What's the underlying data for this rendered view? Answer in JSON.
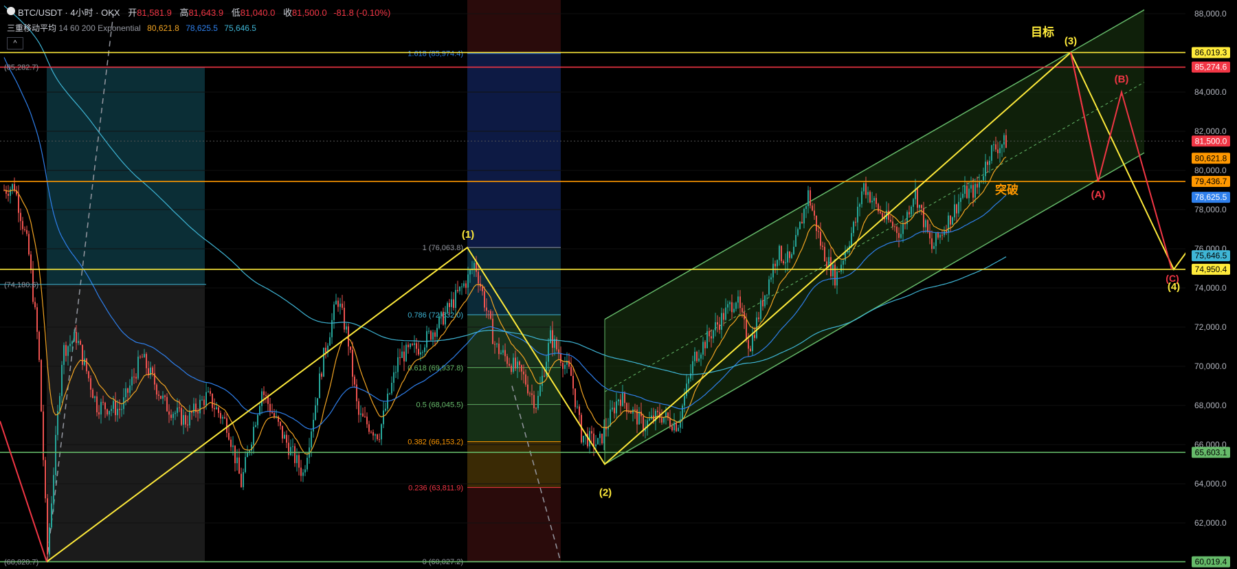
{
  "header": {
    "symbol": "BTC/USDT · 4小时 · OKX",
    "open_label": "开",
    "open": "81,581.9",
    "high_label": "高",
    "high": "81,643.9",
    "low_label": "低",
    "low": "81,040.0",
    "close_label": "收",
    "close": "81,500.0",
    "change": "-81.8 (-0.10%)"
  },
  "indicator": {
    "name": "三重移动平均",
    "params": "14 60 200 Exponential",
    "v1": "80,621.8",
    "v2": "78,625.5",
    "v3": "75,646.5"
  },
  "colors": {
    "up": "#26a69a",
    "down": "#ef5350",
    "ema14": "#f5a623",
    "ema60": "#2f80ed",
    "ema200": "#3fb6d6",
    "yellow": "#ffeb3b",
    "red": "#f23645",
    "orange": "#ff9800",
    "green": "#66bb6a"
  },
  "price_axis": {
    "ticks": [
      "88,000.0",
      "86,000.0",
      "84,000.0",
      "82,000.0",
      "80,000.0",
      "78,000.0",
      "76,000.0",
      "74,000.0",
      "72,000.0",
      "70,000.0",
      "68,000.0",
      "66,000.0",
      "64,000.0",
      "62,000.0"
    ]
  },
  "price_tags": [
    {
      "label": "86,019.3",
      "price": 86019.3,
      "bg": "#ffeb3b",
      "fg": "#000"
    },
    {
      "label": "85,274.6",
      "price": 85274.6,
      "bg": "#f23645",
      "fg": "#fff"
    },
    {
      "label": "81,500.0",
      "price": 81500.0,
      "bg": "#f23645",
      "fg": "#fff"
    },
    {
      "label": "80,621.8",
      "price": 80621.8,
      "bg": "#ff9800",
      "fg": "#000"
    },
    {
      "label": "79,436.7",
      "price": 79436.7,
      "bg": "#ff9800",
      "fg": "#000"
    },
    {
      "label": "78,625.5",
      "price": 78625.5,
      "bg": "#2f80ed",
      "fg": "#fff"
    },
    {
      "label": "75,646.5",
      "price": 75646.5,
      "bg": "#3fb6d6",
      "fg": "#000"
    },
    {
      "label": "74,950.4",
      "price": 74950.4,
      "bg": "#ffeb3b",
      "fg": "#000"
    },
    {
      "label": "65,603.1",
      "price": 65603.1,
      "bg": "#66bb6a",
      "fg": "#000"
    },
    {
      "label": "60,019.4",
      "price": 60019.4,
      "bg": "#66bb6a",
      "fg": "#000"
    }
  ],
  "fib_levels": [
    {
      "label": "1.618 (85,974.4)",
      "price": 85974.4,
      "color": "#2f80ed"
    },
    {
      "label": "1 (76,063.8)",
      "price": 76063.8,
      "color": "#9598a1"
    },
    {
      "label": "0.786 (72,632.0)",
      "price": 72632.0,
      "color": "#3fb6d6"
    },
    {
      "label": "0.618 (69,937.8)",
      "price": 69937.8,
      "color": "#66bb6a"
    },
    {
      "label": "0.5 (68,045.5)",
      "price": 68045.5,
      "color": "#66bb6a"
    },
    {
      "label": "0.382 (66,153.2)",
      "price": 66153.2,
      "color": "#ff9800"
    },
    {
      "label": "0.236 (63,811.9)",
      "price": 63811.9,
      "color": "#f23645"
    },
    {
      "label": "0 (60,027.2)",
      "price": 60027.2,
      "color": "#9598a1"
    }
  ],
  "left_labels": [
    {
      "label": "(85,282.7)",
      "price": 85282.7
    },
    {
      "label": "(74,180.6)",
      "price": 74180.6
    },
    {
      "label": "(60,020.7)",
      "price": 60020.7
    }
  ],
  "wave_labels": {
    "w1": "(1)",
    "w2": "(2)",
    "w3": "(3)",
    "w4": "(4)",
    "wa": "(A)",
    "wb": "(B)",
    "wc": "(C)",
    "target": "目标",
    "breakout": "突破"
  },
  "chart_data": {
    "type": "candlestick",
    "symbol": "BTC/USDT",
    "interval": "4小时",
    "ylim": [
      60000,
      88000
    ],
    "horizontal_levels": [
      86019.3,
      85274.6,
      79436.7,
      74950.4,
      65603.1,
      60019.4
    ],
    "wave_points": [
      {
        "label": "(1)",
        "price": 76063.8
      },
      {
        "label": "(2)",
        "price": 65000
      },
      {
        "label": "(3)",
        "price": 86019.3
      },
      {
        "label": "(A)",
        "price": 79436.7
      },
      {
        "label": "(B)",
        "price": 84000
      },
      {
        "label": "(4)",
        "price": 74950.4
      }
    ],
    "last_close": 81500.0
  }
}
